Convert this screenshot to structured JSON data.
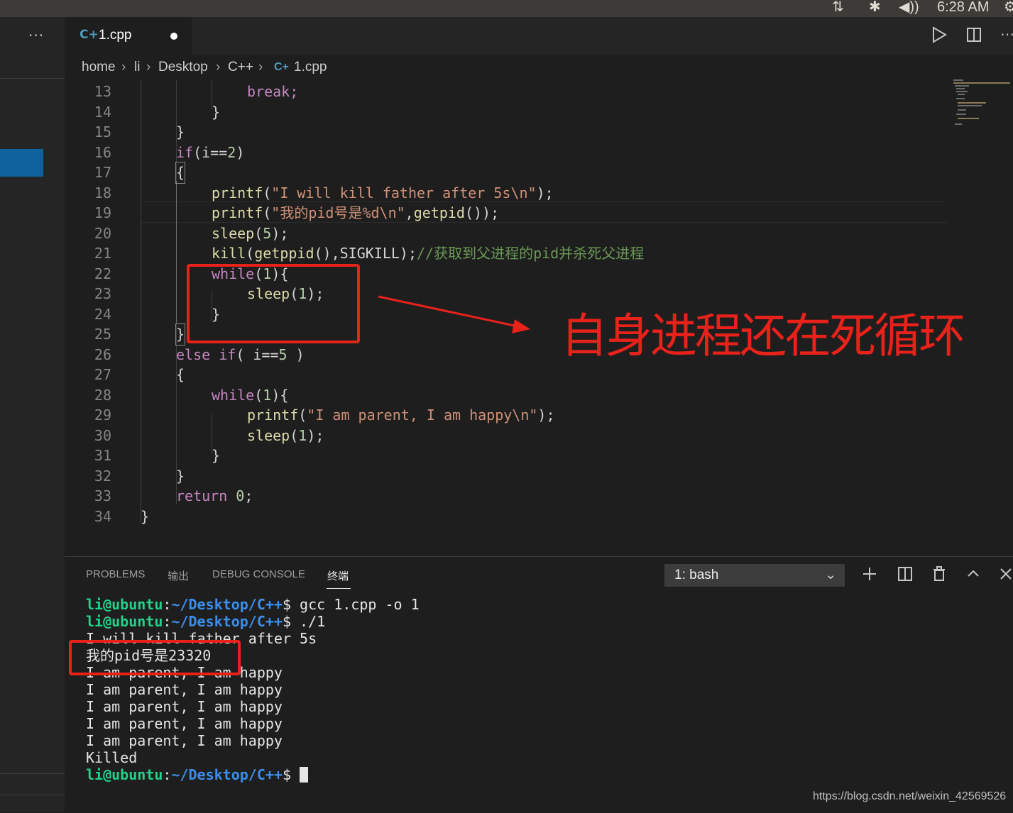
{
  "system": {
    "time": "6:28 AM",
    "icons": [
      "network-icon",
      "bluetooth-icon",
      "volume-icon",
      "settings-icon"
    ]
  },
  "sidebar": {
    "more_label": "···"
  },
  "tab": {
    "icon": "C+",
    "label": "1.cpp",
    "modified": true
  },
  "toolbar": {
    "icons": [
      "run-icon",
      "split-editor-icon",
      "more-actions-icon"
    ]
  },
  "breadcrumb": [
    "home",
    "li",
    "Desktop",
    "C++",
    "1.cpp"
  ],
  "editor": {
    "lines": [
      {
        "n": "13",
        "code": "break;"
      },
      {
        "n": "14",
        "code": "}"
      },
      {
        "n": "15",
        "code": "}"
      },
      {
        "n": "16",
        "code": "if(i==2)"
      },
      {
        "n": "17",
        "code": "{"
      },
      {
        "n": "18",
        "code": "printf(\"I will kill father after 5s\\n\");"
      },
      {
        "n": "19",
        "code": "printf(\"我的pid号是%d\\n\",getpid());"
      },
      {
        "n": "20",
        "code": "sleep(5);"
      },
      {
        "n": "21",
        "code": "kill(getppid(),SIGKILL);//获取到父进程的pid并杀死父进程"
      },
      {
        "n": "22",
        "code": "while(1){"
      },
      {
        "n": "23",
        "code": "sleep(1);"
      },
      {
        "n": "24",
        "code": "}"
      },
      {
        "n": "25",
        "code": "}"
      },
      {
        "n": "26",
        "code": "else if( i==5 )"
      },
      {
        "n": "27",
        "code": "{"
      },
      {
        "n": "28",
        "code": "while(1){"
      },
      {
        "n": "29",
        "code": "printf(\"I am parent, I am happy\\n\");"
      },
      {
        "n": "30",
        "code": "sleep(1);"
      },
      {
        "n": "31",
        "code": "}"
      },
      {
        "n": "32",
        "code": "}"
      },
      {
        "n": "33",
        "code": "return 0;"
      },
      {
        "n": "34",
        "code": "}"
      }
    ]
  },
  "annotation": {
    "text": "自身进程还在死循环"
  },
  "panel": {
    "tabs": [
      "PROBLEMS",
      "输出",
      "DEBUG CONSOLE",
      "终端"
    ],
    "active_tab": "终端",
    "terminal_select": "1: bash",
    "icons": [
      "new-terminal-icon",
      "split-terminal-icon",
      "trash-icon",
      "maximize-icon",
      "close-icon"
    ]
  },
  "terminal": {
    "prompt_user": "li@ubuntu",
    "prompt_sep": ":",
    "prompt_path": "~/Desktop/C++",
    "prompt_end": "$",
    "cmd1": " gcc 1.cpp -o 1",
    "cmd2": " ./1",
    "out1": "I will kill father after 5s",
    "out2": "我的pid号是23320",
    "out3": "I am parent, I am happy",
    "out4": "I am parent, I am happy",
    "out5": "I am parent, I am happy",
    "out6": "I am parent, I am happy",
    "out7": "I am parent, I am happy",
    "out8": "Killed"
  },
  "watermark": "https://blog.csdn.net/weixin_42569526"
}
